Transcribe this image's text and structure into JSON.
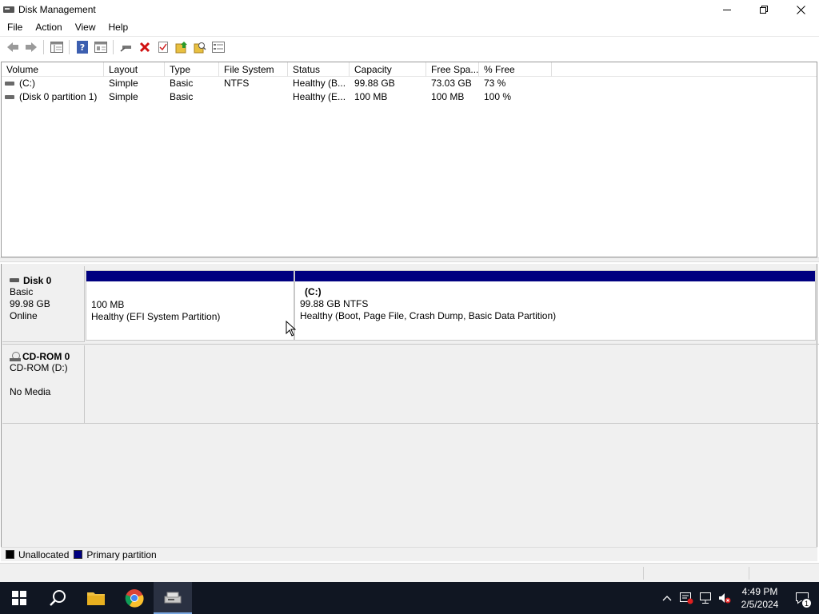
{
  "window": {
    "title": "Disk Management"
  },
  "menu": {
    "items": [
      "File",
      "Action",
      "View",
      "Help"
    ]
  },
  "toolbar": {
    "buttons": [
      "back-icon",
      "forward-icon",
      "console-tree-icon",
      "help-icon",
      "properties-icon",
      "connect-icon",
      "delete-icon",
      "check-icon",
      "import-icon",
      "search-icon",
      "list-icon"
    ]
  },
  "volume_list": {
    "columns": [
      "Volume",
      "Layout",
      "Type",
      "File System",
      "Status",
      "Capacity",
      "Free Spa...",
      "% Free"
    ],
    "rows": [
      {
        "volume": "(C:)",
        "layout": "Simple",
        "type": "Basic",
        "file_system": "NTFS",
        "status": "Healthy (B...",
        "capacity": "99.88 GB",
        "free_space": "73.03 GB",
        "percent_free": "73 %"
      },
      {
        "volume": "(Disk 0 partition 1)",
        "layout": "Simple",
        "type": "Basic",
        "file_system": "",
        "status": "Healthy (E...",
        "capacity": "100 MB",
        "free_space": "100 MB",
        "percent_free": "100 %"
      }
    ]
  },
  "disks": {
    "disk0": {
      "name": "Disk 0",
      "type": "Basic",
      "size": "99.98 GB",
      "state": "Online",
      "partitions": [
        {
          "title": "",
          "size": "100 MB",
          "status": "Healthy (EFI System Partition)"
        },
        {
          "title": "(C:)",
          "size": "99.88 GB NTFS",
          "status": "Healthy (Boot, Page File, Crash Dump, Basic Data Partition)"
        }
      ]
    },
    "cdrom0": {
      "name": "CD-ROM 0",
      "drive": "CD-ROM (D:)",
      "media": "No Media"
    }
  },
  "legend": {
    "unallocated": "Unallocated",
    "primary": "Primary partition",
    "unallocated_color": "#000000",
    "primary_color": "#000080"
  },
  "taskbar": {
    "time": "4:49 PM",
    "date": "2/5/2024",
    "notification_count": "1"
  }
}
